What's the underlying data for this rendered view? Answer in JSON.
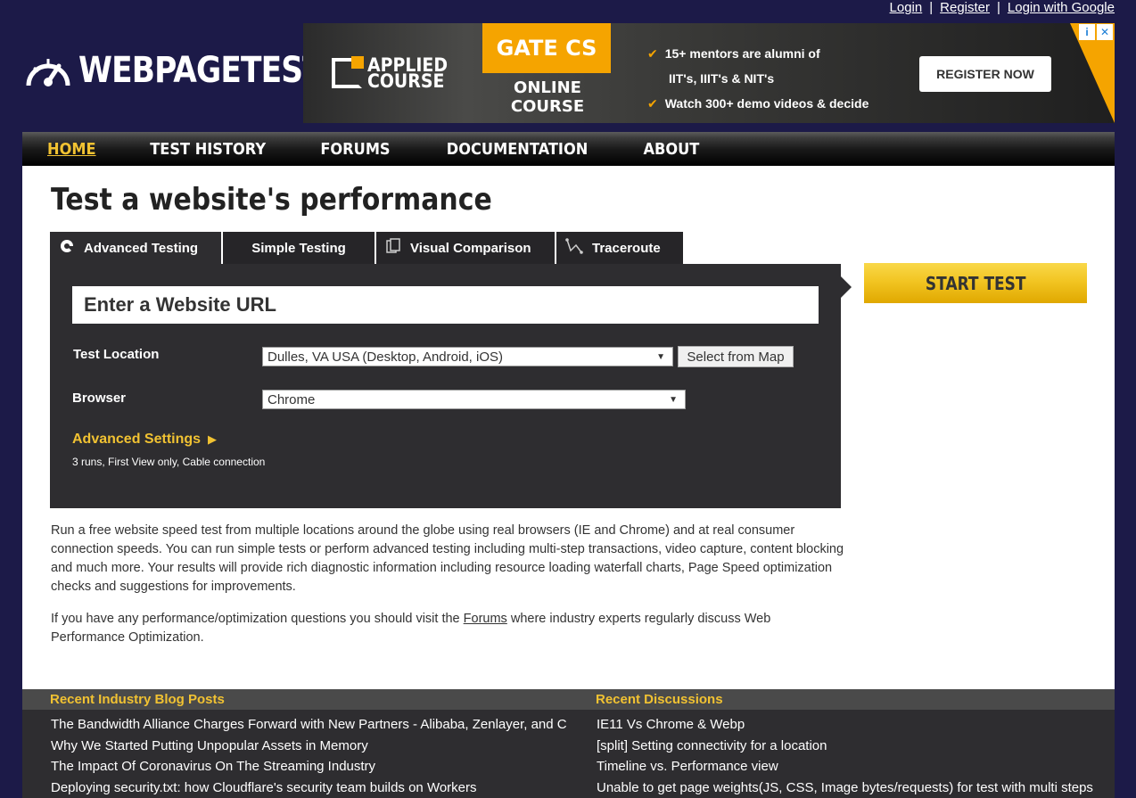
{
  "auth": {
    "login": "Login",
    "register": "Register",
    "login_google": "Login with Google",
    "sep": "|"
  },
  "logo": {
    "text": "WEBPAGETEST",
    "icon": "speedometer-icon"
  },
  "ad": {
    "brand_line1": "APPLIED",
    "brand_line2": "COURSE",
    "headline": "GATE CS",
    "subline": "ONLINE COURSE",
    "points": [
      "15+ mentors are alumni of",
      "IIT's, IIIT's & NIT's",
      "Watch 300+ demo videos & decide"
    ],
    "cta": "REGISTER NOW",
    "info_icon": "i",
    "close_icon": "✕",
    "accent": "#f5a400"
  },
  "nav": {
    "items": [
      {
        "label": "HOME",
        "active": true
      },
      {
        "label": "TEST HISTORY"
      },
      {
        "label": "FORUMS"
      },
      {
        "label": "DOCUMENTATION"
      },
      {
        "label": "ABOUT"
      }
    ]
  },
  "page": {
    "title": "Test a website's performance"
  },
  "tabs": [
    {
      "label": "Advanced Testing",
      "icon": "gear-icon"
    },
    {
      "label": "Simple Testing",
      "icon": ""
    },
    {
      "label": "Visual Comparison",
      "icon": "document-icon"
    },
    {
      "label": "Traceroute",
      "icon": "trace-icon"
    }
  ],
  "form": {
    "url_placeholder": "Enter a Website URL",
    "location_label": "Test Location",
    "location_value": "Dulles, VA USA (Desktop, Android, iOS)",
    "map_button": "Select from Map",
    "browser_label": "Browser",
    "browser_value": "Chrome",
    "advanced_label": "Advanced Settings",
    "advanced_summary": "3 runs, First View only, Cable connection",
    "start_button": "START TEST"
  },
  "description": {
    "p1": "Run a free website speed test from multiple locations around the globe using real browsers (IE and Chrome) and at real consumer connection speeds. You can run simple tests or perform advanced testing including multi-step transactions, video capture, content blocking and much more. Your results will provide rich diagnostic information including resource loading waterfall charts, Page Speed optimization checks and suggestions for improvements.",
    "p2_before": "If you have any performance/optimization questions you should visit the ",
    "p2_link": "Forums",
    "p2_after": " where industry experts regularly discuss Web Performance Optimization."
  },
  "blog": {
    "heading": "Recent Industry Blog Posts",
    "items": [
      "The Bandwidth Alliance Charges Forward with New Partners - Alibaba, Zenlayer, and C",
      "Why We Started Putting Unpopular Assets in Memory",
      "The Impact Of Coronavirus On The Streaming Industry",
      "Deploying security.txt: how Cloudflare's security team builds on Workers"
    ]
  },
  "discussions": {
    "heading": "Recent Discussions",
    "items": [
      "IE11 Vs Chrome & Webp",
      "[split] Setting connectivity for a location",
      "Timeline vs. Performance view",
      "Unable to get page weights(JS, CSS, Image bytes/requests) for test with multi steps"
    ]
  },
  "colors": {
    "background": "#1c1a48",
    "panel": "#2e2d30",
    "accent": "#f1c232"
  }
}
